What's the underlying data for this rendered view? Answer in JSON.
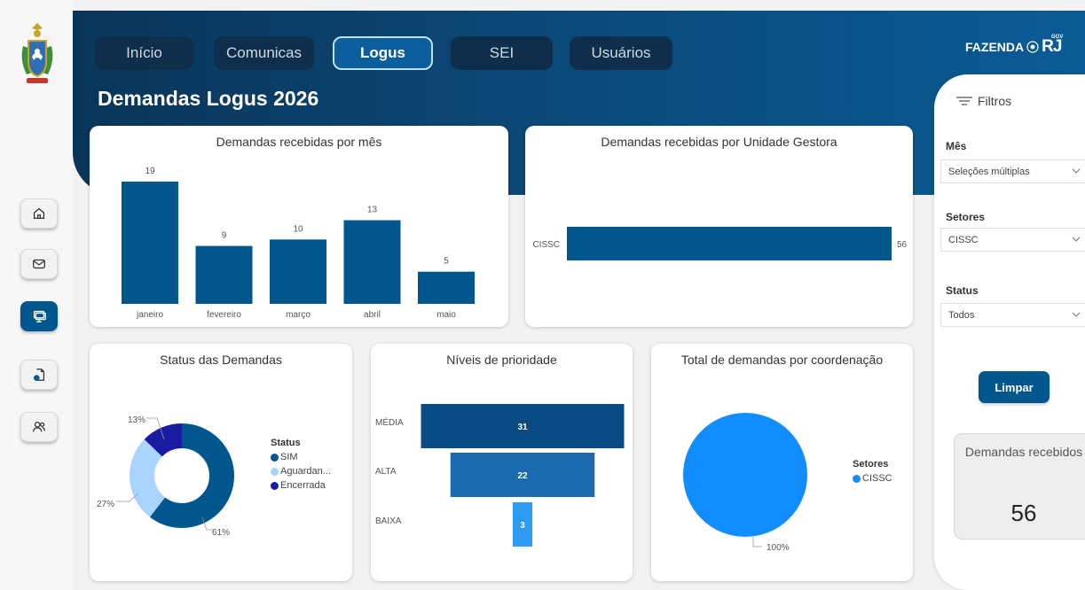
{
  "nav": {
    "tabs": [
      "Início",
      "Comunicas",
      "Logus",
      "SEI",
      "Usuários"
    ],
    "active_tab": "Logus",
    "side_icons": [
      "home-icon",
      "mail-icon",
      "monitor-icon",
      "document-gear-icon",
      "users-icon"
    ]
  },
  "brand": {
    "name": "FAZENDA",
    "gov": "GOV",
    "rj": "RJ"
  },
  "page": {
    "title": "Demandas Logus 2026"
  },
  "colors": {
    "primary": "#00578e",
    "dark": "#0e2e4c",
    "light_blue": "#a8d4ff",
    "navy": "#1a1ba3",
    "bright": "#118dff"
  },
  "charts": {
    "monthly": {
      "title": "Demandas recebidas por mês",
      "chart_data": {
        "type": "bar",
        "categories": [
          "janeiro",
          "fevereiro",
          "março",
          "abril",
          "maio"
        ],
        "values": [
          19,
          9,
          10,
          13,
          5
        ]
      }
    },
    "unit": {
      "title": "Demandas recebidas por Unidade Gestora",
      "chart_data": {
        "type": "bar",
        "orientation": "horizontal",
        "categories": [
          "CISSC"
        ],
        "values": [
          56
        ]
      }
    },
    "status": {
      "title": "Status das Demandas",
      "legend_title": "Status",
      "chart_data": {
        "type": "pie",
        "donut": true,
        "series": [
          {
            "name": "SIM",
            "percent": 61,
            "label": "61%",
            "color": "#00578e"
          },
          {
            "name": "Aguardan...",
            "percent": 27,
            "label": "27%",
            "color": "#a8d4ff"
          },
          {
            "name": "Encerrada",
            "percent": 13,
            "label": "13%",
            "color": "#1a1ba3"
          }
        ]
      }
    },
    "priority": {
      "title": "Níveis de prioridade",
      "chart_data": {
        "type": "bar",
        "funnel": true,
        "categories": [
          "MÉDIA",
          "ALTA",
          "BAIXA"
        ],
        "values": [
          31,
          22,
          3
        ],
        "colors": [
          "#0b4b84",
          "#1a6aad",
          "#2d9bf0"
        ]
      }
    },
    "coord": {
      "title": "Total de demandas por coordenação",
      "legend_title": "Setores",
      "chart_data": {
        "type": "pie",
        "series": [
          {
            "name": "CISSC",
            "percent": 100,
            "label": "100%",
            "color": "#118dff"
          }
        ]
      }
    }
  },
  "filters": {
    "header": "Filtros",
    "mes": {
      "label": "Mês",
      "value": "Seleções múltiplas"
    },
    "setores": {
      "label": "Setores",
      "value": "CISSC"
    },
    "status": {
      "label": "Status",
      "value": "Todos"
    },
    "clear_label": "Limpar",
    "kpi_label": "Demandas recebidos",
    "kpi_value": "56"
  }
}
